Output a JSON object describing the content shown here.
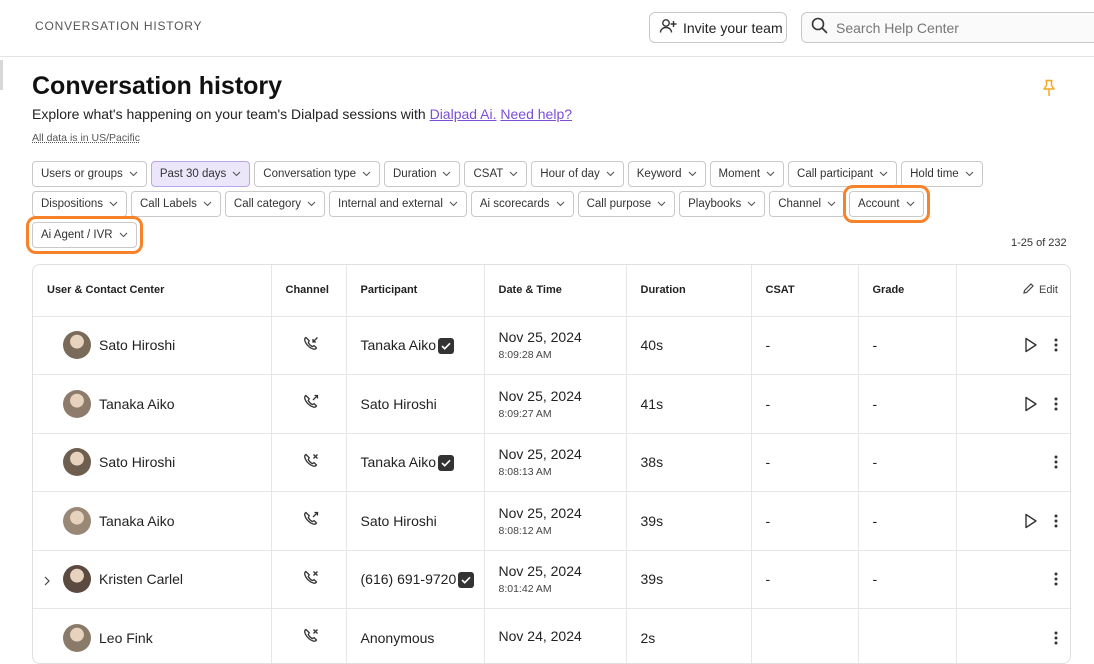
{
  "header": {
    "breadcrumb": "CONVERSATION HISTORY",
    "invite_label": "Invite your team",
    "search_placeholder": "Search Help Center"
  },
  "page": {
    "title": "Conversation history",
    "subtitle_prefix": "Explore what's happening on your team's Dialpad sessions with",
    "link_dialpad_ai": "Dialpad Ai.",
    "link_need_help": "Need help?",
    "tz_note": "All data is in US/Pacific",
    "count": "1-25 of 232"
  },
  "filters": {
    "row1": [
      "Users or groups",
      "Past 30 days",
      "Conversation type",
      "Duration",
      "CSAT",
      "Hour of day",
      "Keyword",
      "Moment",
      "Call participant",
      "Hold time"
    ],
    "row2": [
      "Dispositions",
      "Call Labels",
      "Call category",
      "Internal and external",
      "Ai scorecards",
      "Call purpose",
      "Playbooks",
      "Channel",
      "Account"
    ],
    "row3": [
      "Ai Agent / IVR"
    ],
    "active": "Past 30 days",
    "highlighted": [
      "Account",
      "Ai Agent / IVR"
    ]
  },
  "table": {
    "columns": [
      "User & Contact Center",
      "Channel",
      "Participant",
      "Date & Time",
      "Duration",
      "CSAT",
      "Grade"
    ],
    "edit_label": "Edit",
    "rows": [
      {
        "user": "Sato Hiroshi",
        "channel": "call-incoming-icon",
        "participant": "Tanaka Aiko",
        "verified": true,
        "date": "Nov 25, 2024",
        "time": "8:09:28 AM",
        "duration": "40s",
        "csat": "-",
        "grade": "-",
        "play": true,
        "expand": false
      },
      {
        "user": "Tanaka Aiko",
        "channel": "call-outgoing-icon",
        "participant": "Sato Hiroshi",
        "verified": false,
        "date": "Nov 25, 2024",
        "time": "8:09:27 AM",
        "duration": "41s",
        "csat": "-",
        "grade": "-",
        "play": true,
        "expand": false
      },
      {
        "user": "Sato Hiroshi",
        "channel": "call-missed-icon",
        "participant": "Tanaka Aiko",
        "verified": true,
        "date": "Nov 25, 2024",
        "time": "8:08:13 AM",
        "duration": "38s",
        "csat": "-",
        "grade": "-",
        "play": false,
        "expand": false
      },
      {
        "user": "Tanaka Aiko",
        "channel": "call-outgoing-icon",
        "participant": "Sato Hiroshi",
        "verified": false,
        "date": "Nov 25, 2024",
        "time": "8:08:12 AM",
        "duration": "39s",
        "csat": "-",
        "grade": "-",
        "play": true,
        "expand": false
      },
      {
        "user": "Kristen Carlel",
        "channel": "call-missed-icon",
        "participant": "(616) 691-9720",
        "verified": true,
        "date": "Nov 25, 2024",
        "time": "8:01:42 AM",
        "duration": "39s",
        "csat": "-",
        "grade": "-",
        "play": false,
        "expand": true
      },
      {
        "user": "Leo Fink",
        "channel": "call-missed-icon",
        "participant": "Anonymous",
        "verified": false,
        "date": "Nov 24, 2024",
        "time": "",
        "duration": "2s",
        "csat": "",
        "grade": "",
        "play": false,
        "expand": false
      }
    ]
  },
  "colors": {
    "accent": "#7c4dd6",
    "highlight": "#f7822a",
    "active_chip_bg": "#ece6fb",
    "pin": "#f5a623"
  }
}
